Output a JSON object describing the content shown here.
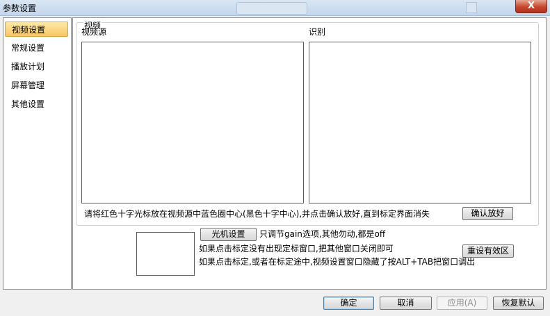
{
  "window": {
    "title": "参数设置",
    "close_glyph": "X"
  },
  "sidebar": {
    "items": [
      {
        "label": "视频设置",
        "active": true
      },
      {
        "label": "常规设置"
      },
      {
        "label": "播放计划"
      },
      {
        "label": "屏幕管理"
      },
      {
        "label": "其他设置"
      }
    ]
  },
  "video": {
    "group_title": "视频",
    "source_label": "视频源",
    "recognize_label": "识别",
    "instruction": "请将红色十字光标放在视频源中蓝色圈中心(黑色十字中心),并点击确认放好,直到标定界面消失",
    "confirm_button": "确认放好"
  },
  "camera": {
    "settings_button": "光机设置",
    "gain_note": "只调节gain选项,其他勿动,都是off",
    "hint1": "如果点击标定没有出现定标窗口,把其他窗口关闭即可",
    "hint2": "如果点击标定,或者在标定途中,视频设置窗口隐藏了按ALT+TAB把窗口调出",
    "reset_button": "重设有效区"
  },
  "footer": {
    "ok": "确定",
    "cancel": "取消",
    "apply": "应用(A)",
    "restore": "恢复默认"
  }
}
